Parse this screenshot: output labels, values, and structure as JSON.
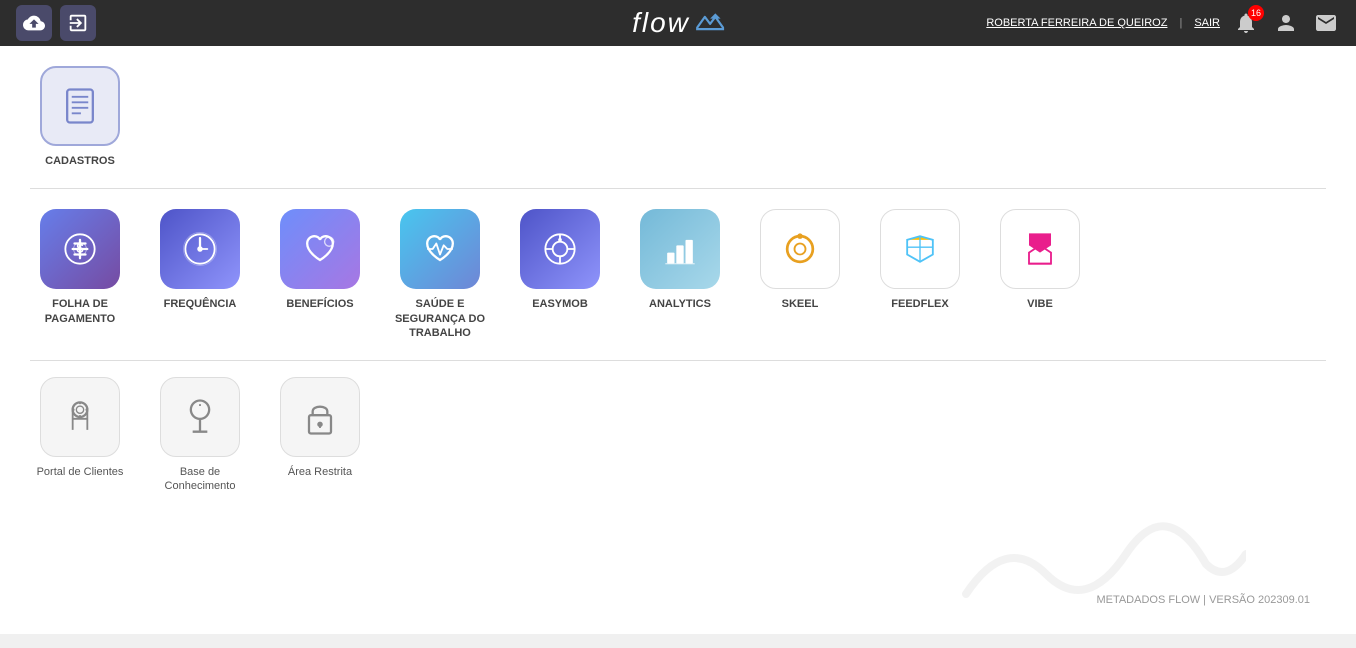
{
  "header": {
    "logo": "flow",
    "user_name": "ROBERTA FERREIRA DE QUEIROZ",
    "separator": "|",
    "sair_label": "SAIR",
    "notif_count": "16"
  },
  "sections": {
    "cadastros": {
      "label": "CADASTROS"
    },
    "main_apps": [
      {
        "id": "folha",
        "label": "FOLHA DE\nPAGAMENTO"
      },
      {
        "id": "frequencia",
        "label": "FREQUÊNCIA"
      },
      {
        "id": "beneficios",
        "label": "BENEFÍCIOS"
      },
      {
        "id": "saude",
        "label": "SAÚDE E\nSEGURANÇA DO\nTRABALHO"
      },
      {
        "id": "easymob",
        "label": "EASYMOB"
      },
      {
        "id": "analytics",
        "label": "ANALYTICS"
      },
      {
        "id": "skeel",
        "label": "SKEEL"
      },
      {
        "id": "feedflex",
        "label": "FEEDFLEX"
      },
      {
        "id": "vibe",
        "label": "VIBE"
      }
    ],
    "other_apps": [
      {
        "id": "portal",
        "label": "Portal de Clientes"
      },
      {
        "id": "base",
        "label": "Base de\nConhecimento"
      },
      {
        "id": "restrita",
        "label": "Área Restrita"
      }
    ]
  },
  "footer": {
    "version_text": "METADADOS FLOW | VERSÃO 202309.01"
  }
}
